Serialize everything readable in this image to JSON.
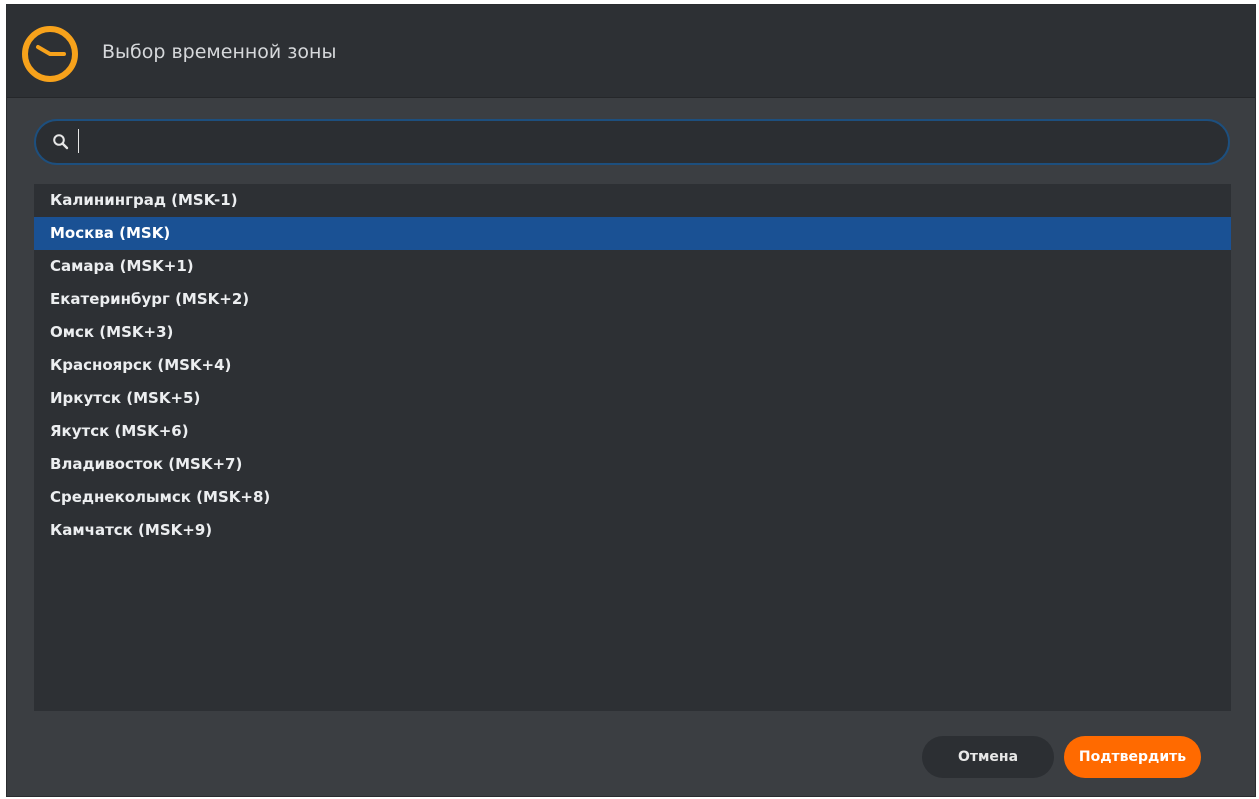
{
  "dialog": {
    "title": "Выбор временной зоны",
    "icon": "clock-icon",
    "accent_color": "#f7a21b"
  },
  "search": {
    "value": "",
    "placeholder": "",
    "icon": "search-icon"
  },
  "timezones": [
    {
      "label": "Калининград (MSK-1)",
      "selected": false
    },
    {
      "label": "Москва (MSK)",
      "selected": true
    },
    {
      "label": "Самара (MSK+1)",
      "selected": false
    },
    {
      "label": "Екатеринбург (MSK+2)",
      "selected": false
    },
    {
      "label": "Омск (MSK+3)",
      "selected": false
    },
    {
      "label": "Красноярск (MSK+4)",
      "selected": false
    },
    {
      "label": "Иркутск (MSK+5)",
      "selected": false
    },
    {
      "label": "Якутск (MSK+6)",
      "selected": false
    },
    {
      "label": "Владивосток (MSK+7)",
      "selected": false
    },
    {
      "label": "Среднеколымск (MSK+8)",
      "selected": false
    },
    {
      "label": "Камчатск (MSK+9)",
      "selected": false
    }
  ],
  "buttons": {
    "cancel_label": "Отмена",
    "confirm_label": "Подтвердить",
    "confirm_color": "#ff6a00",
    "selection_color": "#1a5194"
  }
}
